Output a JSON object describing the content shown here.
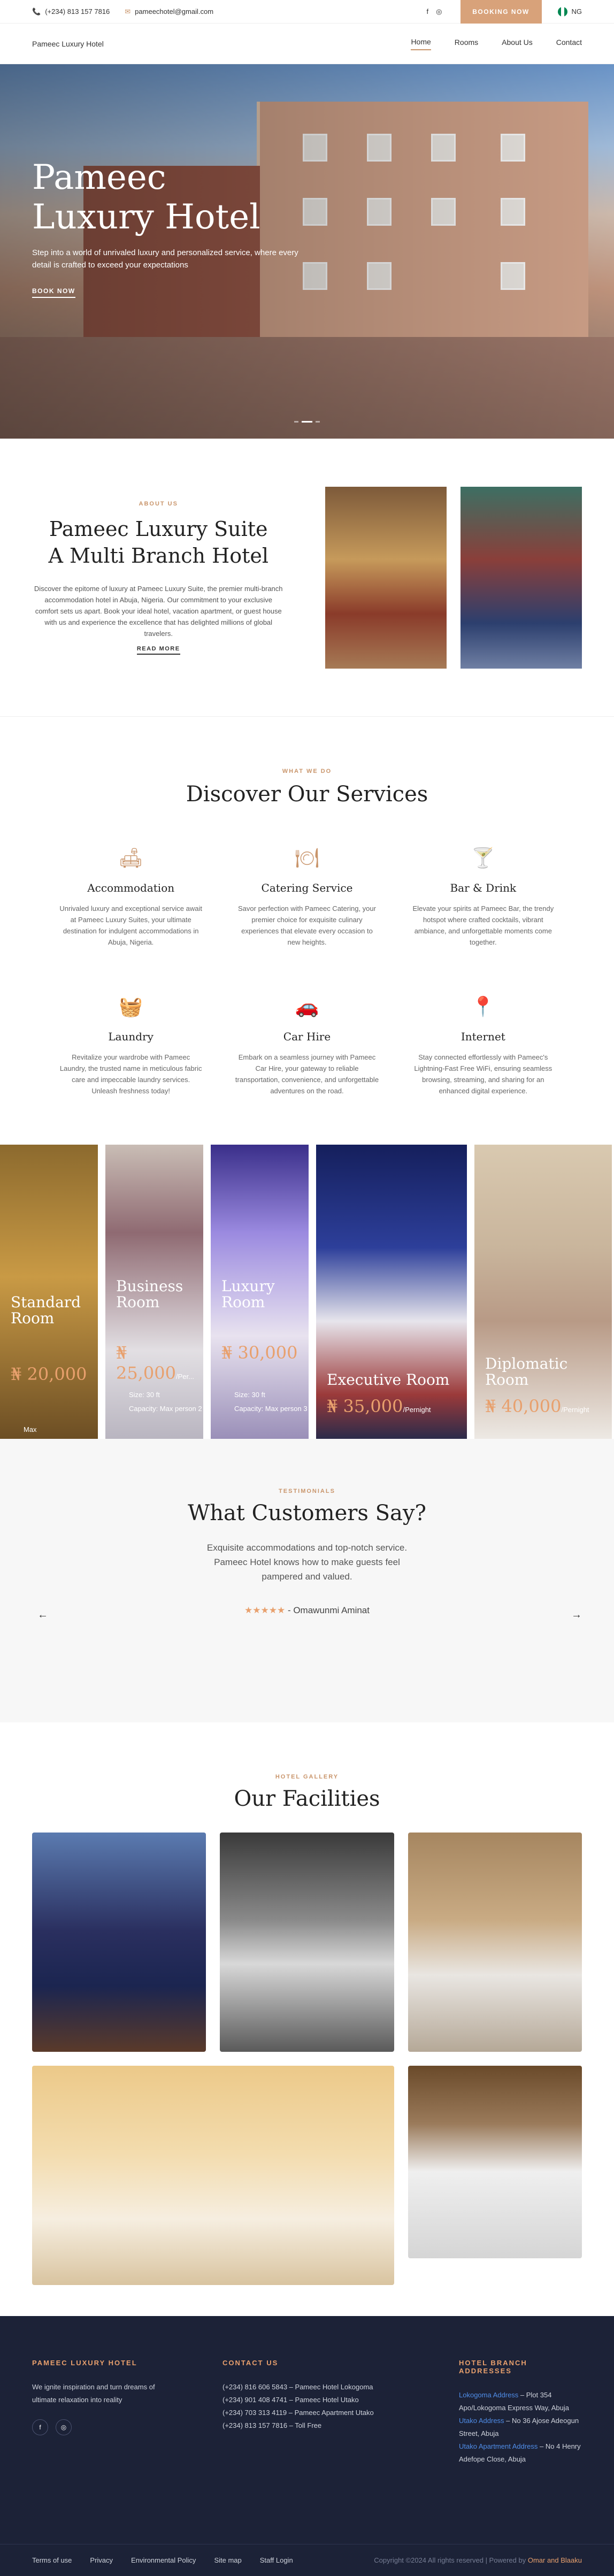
{
  "topbar": {
    "phone": "(+234) 813 157 7816",
    "email": "pameechotel@gmail.com",
    "book": "BOOKING NOW",
    "lang": "NG"
  },
  "nav": {
    "brand": "Pameec Luxury Hotel",
    "links": [
      "Home",
      "Rooms",
      "About Us",
      "Contact"
    ]
  },
  "hero": {
    "title_1": "Pameec",
    "title_2": "Luxury Hotel",
    "text": "Step into a world of unrivaled luxury and personalized service, where every detail is crafted to exceed your expectations",
    "cta": "BOOK NOW"
  },
  "about": {
    "eyebrow": "ABOUT US",
    "title_1": "Pameec Luxury Suite",
    "title_2": "A Multi Branch Hotel",
    "text": "Discover the epitome of luxury at Pameec Luxury Suite, the premier multi-branch accommodation hotel in Abuja, Nigeria. Our commitment to your exclusive comfort sets us apart. Book your ideal hotel, vacation apartment, or guest house with us and experience the excellence that has delighted millions of global travelers.",
    "more": "READ MORE"
  },
  "services": {
    "eyebrow": "WHAT WE DO",
    "title": "Discover Our Services",
    "items": [
      {
        "icon": "sofa-icon",
        "glyph": "🛋",
        "name": "Accommodation",
        "text": "Unrivaled luxury and exceptional service await at Pameec Luxury Suites, your ultimate destination for indulgent accommodations in Abuja, Nigeria."
      },
      {
        "icon": "dining-icon",
        "glyph": "🍽",
        "name": "Catering Service",
        "text": "Savor perfection with Pameec Catering, your premier choice for exquisite culinary experiences that elevate every occasion to new heights."
      },
      {
        "icon": "cocktail-icon",
        "glyph": "🍸",
        "name": "Bar & Drink",
        "text": "Elevate your spirits at Pameec Bar, the trendy hotspot where crafted cocktails, vibrant ambiance, and unforgettable moments come together."
      },
      {
        "icon": "laundry-icon",
        "glyph": "🧺",
        "name": "Laundry",
        "text": "Revitalize your wardrobe with Pameec Laundry, the trusted name in meticulous fabric care and impeccable laundry services. Unleash freshness today!"
      },
      {
        "icon": "car-icon",
        "glyph": "🚗",
        "name": "Car Hire",
        "text": "Embark on a seamless journey with Pameec Car Hire, your gateway to reliable transportation, convenience, and unforgettable adventures on the road."
      },
      {
        "icon": "location-icon",
        "glyph": "📍",
        "name": "Internet",
        "text": "Stay connected effortlessly with Pameec's Lightning-Fast Free WiFi, ensuring seamless browsing, streaming, and sharing for an enhanced digital experience."
      }
    ]
  },
  "rooms": [
    {
      "name_1": "Standard",
      "name_2": "Room",
      "price": "₦ 20,000",
      "per": "",
      "size": "",
      "cap": "Max"
    },
    {
      "name_1": "Business",
      "name_2": "Room",
      "price": "₦ 25,000",
      "per": "/Per...",
      "size": "Size: 30 ft",
      "cap": "Capacity: Max person 2"
    },
    {
      "name_1": "Luxury",
      "name_2": "Room",
      "price": "₦ 30,000",
      "per": "",
      "size": "Size: 30 ft",
      "cap": "Capacity: Max person 3"
    },
    {
      "name_1": "Executive Room",
      "name_2": "",
      "price": "₦ 35,000",
      "per": "/Pernight",
      "size": "",
      "cap": ""
    },
    {
      "name_1": "Diplomatic",
      "name_2": "Room",
      "price": "₦ 40,000",
      "per": "/Pernight",
      "size": "",
      "cap": ""
    }
  ],
  "testimonials": {
    "eyebrow": "TESTIMONIALS",
    "title": "What Customers Say?",
    "quote": "Exquisite accommodations and top-notch service. Pameec Hotel knows how to make guests feel pampered and valued.",
    "stars": "★★★★★",
    "author": "- Omawunmi Aminat",
    "prev": "←",
    "next": "→"
  },
  "gallery": {
    "eyebrow": "HOTEL GALLERY",
    "title": "Our Facilities"
  },
  "footer": {
    "brand_title": "PAMEEC LUXURY HOTEL",
    "brand_text": "We ignite inspiration and turn dreams of ultimate relaxation into reality",
    "contact_title": "CONTACT US",
    "contacts": [
      "(+234) 816 606 5843 – Pameec Hotel Lokogoma",
      "(+234) 901 408 4741 – Pameec Hotel Utako",
      "(+234) 703 313 4119 – Pameec Apartment Utako",
      "(+234) 813 157 7816 – Toll Free"
    ],
    "branch_title": "HOTEL BRANCH ADDRESSES",
    "branches": [
      {
        "name": "Lokogoma Address",
        "addr": " – Plot 354 Apo/Lokogoma Express Way, Abuja"
      },
      {
        "name": "Utako Address",
        "addr": " – No 36 Ajose Adeogun Street, Abuja"
      },
      {
        "name": "Utako Apartment Address",
        "addr": " – No 4 Henry Adefope Close, Abuja"
      }
    ],
    "links": [
      "Terms of use",
      "Privacy",
      "Environmental Policy",
      "Site map",
      "Staff Login"
    ],
    "copy": "Copyright ©2024 All rights reserved | Powered by ",
    "copy_by": "Omar and Blaaku"
  },
  "colors": {
    "accent": "#c9956b",
    "footer_bg": "#1c2237"
  }
}
